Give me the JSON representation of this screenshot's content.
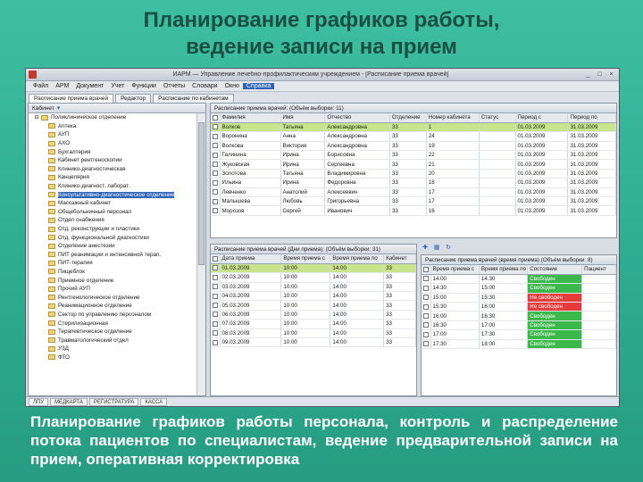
{
  "slide": {
    "title_line1": "Планирование графиков работы,",
    "title_line2": "ведение записи на прием",
    "caption": "Планирование графиков работы персонала, контроль и распределение потока пациентов по специалистам, ведение предварительной записи на прием, оперативная корректировка"
  },
  "window": {
    "title": "ИАРМ — Управление лечебно-профилактическим учреждением - [Расписание приема врачей]",
    "controls": [
      "_",
      "□",
      "×"
    ]
  },
  "menu": [
    "Файл",
    "АРМ",
    "Документ",
    "Учет",
    "Функции",
    "Отчеты",
    "Словари",
    "Окно",
    "Справка"
  ],
  "menu_active_index": 8,
  "tabs": [
    "Расписание приема врачей",
    "Редактор",
    "Расписание по кабинетам"
  ],
  "tree_header": "Кабинет",
  "tree": {
    "root": "Поликлиническое отделение",
    "items": [
      "Аптека",
      "АУП",
      "АХО",
      "Бухгалтерия",
      "Кабинет рентгеноскопии",
      "Клинико-диагностическая",
      "Канцелярия",
      "Клинико-диагност. лаборат.",
      "Консультативно-диагностическое отделение",
      "Массажный кабинет",
      "Общебольничный персонал",
      "Отдел снабжения",
      "Отд. реконструкции и пластики",
      "Отд. функциональной диагностики",
      "Отделение анестезии",
      "ПИТ реанимации и интенсивной терап.",
      "ПИТ-терапия",
      "Пищеблок",
      "Приемное отделение",
      "Прочий АУП",
      "Рентгенологическое отделение",
      "Реанимационное отделение",
      "Сектор по управлению персоналом",
      "Стерилизационная",
      "Терапевтическое отделение",
      "Травматологический отдел",
      "УЗД",
      "ФТО"
    ],
    "selected_index": 8
  },
  "top_grid": {
    "title": "Расписание приема врачей: (Объём выборки: 11)",
    "headers": [
      "Фамилия",
      "Имя",
      "Отчество",
      "Отделение",
      "Номер кабинета",
      "Статус",
      "Период с",
      "Период по"
    ],
    "rows": [
      [
        "Волков",
        "Татьяна",
        "Александровна",
        "33",
        "1",
        "",
        "01.03.2009",
        "31.03.2009"
      ],
      [
        "Воронина",
        "Анна",
        "Александровна",
        "33",
        "24",
        "",
        "01.03.2009",
        "31.03.2009"
      ],
      [
        "Волкова",
        "Виктория",
        "Александровна",
        "33",
        "19",
        "",
        "01.03.2009",
        "31.03.2009"
      ],
      [
        "Галинина",
        "Ирина",
        "Борисовна",
        "33",
        "22",
        "",
        "01.03.2009",
        "31.03.2009"
      ],
      [
        "Жуковская",
        "Ирина",
        "Сергеевна",
        "33",
        "21",
        "",
        "01.03.2009",
        "31.03.2009"
      ],
      [
        "Золотова",
        "Татьяна",
        "Владимировна",
        "33",
        "20",
        "",
        "01.03.2009",
        "31.03.2009"
      ],
      [
        "Ильина",
        "Ирина",
        "Федоровна",
        "33",
        "18",
        "",
        "01.03.2009",
        "31.03.2009"
      ],
      [
        "Левченко",
        "Анатолий",
        "Алексеевич",
        "33",
        "17",
        "",
        "01.03.2009",
        "31.03.2009"
      ],
      [
        "Малышева",
        "Любовь",
        "Григорьевна",
        "33",
        "17",
        "",
        "01.03.2009",
        "31.03.2009"
      ],
      [
        "Морозов",
        "Сергей",
        "Иванович",
        "33",
        "16",
        "",
        "01.03.2009",
        "31.03.2009"
      ]
    ],
    "selected_row": 0
  },
  "bottom_left_grid": {
    "title": "Расписание приема врачей (Дни приема): (Объём выборки: 31)",
    "headers": [
      "Дата приема",
      "Время приема с",
      "Время приема по",
      "Кабинет"
    ],
    "rows": [
      [
        "01.03.2009",
        "10:00",
        "14:00",
        "33"
      ],
      [
        "02.03.2009",
        "10:00",
        "14:00",
        "33"
      ],
      [
        "03.03.2009",
        "10:00",
        "14:00",
        "33"
      ],
      [
        "04.03.2009",
        "10:00",
        "14:00",
        "33"
      ],
      [
        "05.03.2009",
        "10:00",
        "14:00",
        "33"
      ],
      [
        "06.03.2009",
        "10:00",
        "14:00",
        "33"
      ],
      [
        "07.03.2009",
        "10:00",
        "14:00",
        "33"
      ],
      [
        "08.03.2009",
        "10:00",
        "14:00",
        "33"
      ],
      [
        "09.03.2009",
        "10:00",
        "14:00",
        "33"
      ]
    ],
    "selected_row": 0
  },
  "bottom_right_grid": {
    "title": "Расписание приема врачей (время приема) (Объём выборки: 8)",
    "headers": [
      "Время приема с",
      "Время приема по",
      "Состояние",
      "Пациент"
    ],
    "rows": [
      [
        "14:00",
        "14:30",
        "Свободен",
        ""
      ],
      [
        "14:30",
        "15:00",
        "Свободен",
        ""
      ],
      [
        "15:00",
        "15:30",
        "Не свободен",
        ""
      ],
      [
        "15:30",
        "16:00",
        "Не свободен",
        ""
      ],
      [
        "16:00",
        "16:30",
        "Свободен",
        ""
      ],
      [
        "16:30",
        "17:00",
        "Свободен",
        ""
      ],
      [
        "17:00",
        "17:30",
        "Свободен",
        ""
      ],
      [
        "17:30",
        "18:00",
        "Свободен",
        ""
      ]
    ],
    "status_colors": {
      "free": "#3bb84a",
      "busy": "#e53b3b"
    },
    "free_label": "Свободен"
  },
  "statusbar": [
    "ЛПУ",
    "МЕДКАРТА",
    "РЕГИСТРАТУРА",
    "КАССА"
  ],
  "colors": {
    "background": "#2fae91",
    "selection": "#c9e58c",
    "accent": "#2f63b8"
  }
}
